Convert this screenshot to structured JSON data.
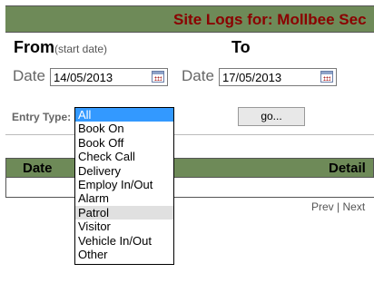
{
  "page": {
    "title": "Site Logs for: Mollbee Sec",
    "from_label": "From",
    "from_sub": "(start date)",
    "to_label": "To"
  },
  "from": {
    "date_label": "Date",
    "value": "14/05/2013"
  },
  "to": {
    "date_label": "Date",
    "value": "17/05/2013"
  },
  "entry_type": {
    "label": "Entry Type:",
    "selected": "All",
    "options": [
      "All",
      "Book On",
      "Book Off",
      "Check Call",
      "Delivery",
      "Employ In/Out",
      "Alarm",
      "Patrol",
      "Visitor",
      "Vehicle In/Out",
      "Other"
    ],
    "highlighted": "Patrol"
  },
  "go_button": "go...",
  "table": {
    "columns": [
      "Date",
      "Detail"
    ]
  },
  "pager": {
    "prev": "Prev",
    "separator": "|",
    "next": "Next"
  }
}
